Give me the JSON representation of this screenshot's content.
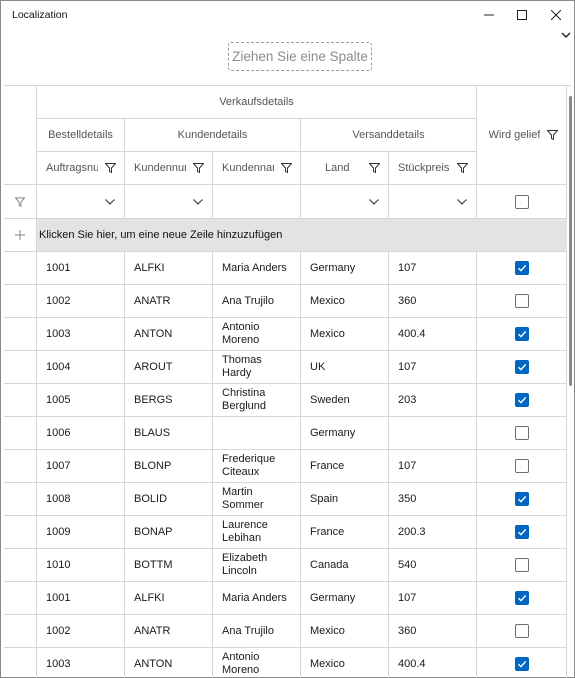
{
  "window": {
    "title": "Localization",
    "controls": [
      "minimize-icon",
      "maximize-icon",
      "close-icon"
    ]
  },
  "group_panel": {
    "placeholder": "Ziehen Sie eine Spalte"
  },
  "headers": {
    "band_top": "Verkaufsdetails",
    "band_order": "Bestelldetails",
    "band_customer": "Kundendetails",
    "band_shipping": "Versanddetails",
    "delivered": "Wird gelief",
    "order_id": "Auftragsnu",
    "customer_id": "Kundennur",
    "customer_name": "Kundennar",
    "country": "Land",
    "unit_price": "Stückpreis"
  },
  "add_row_text": "Klicken Sie hier, um eine neue Zeile hinzuzufügen",
  "rows": [
    {
      "order_id": "1001",
      "customer_id": "ALFKI",
      "customer_name": "Maria Anders",
      "country": "Germany",
      "unit_price": "107",
      "delivered": true
    },
    {
      "order_id": "1002",
      "customer_id": "ANATR",
      "customer_name": "Ana Trujilo",
      "country": "Mexico",
      "unit_price": "360",
      "delivered": false
    },
    {
      "order_id": "1003",
      "customer_id": "ANTON",
      "customer_name": "Antonio Moreno",
      "country": "Mexico",
      "unit_price": "400.4",
      "delivered": true
    },
    {
      "order_id": "1004",
      "customer_id": "AROUT",
      "customer_name": "Thomas Hardy",
      "country": "UK",
      "unit_price": "107",
      "delivered": true
    },
    {
      "order_id": "1005",
      "customer_id": "BERGS",
      "customer_name": "Christina Berglund",
      "country": "Sweden",
      "unit_price": "203",
      "delivered": true
    },
    {
      "order_id": "1006",
      "customer_id": "BLAUS",
      "customer_name": "",
      "country": "Germany",
      "unit_price": "",
      "delivered": false
    },
    {
      "order_id": "1007",
      "customer_id": "BLONP",
      "customer_name": "Frederique Citeaux",
      "country": "France",
      "unit_price": "107",
      "delivered": false
    },
    {
      "order_id": "1008",
      "customer_id": "BOLID",
      "customer_name": "Martin Sommer",
      "country": "Spain",
      "unit_price": "350",
      "delivered": true
    },
    {
      "order_id": "1009",
      "customer_id": "BONAP",
      "customer_name": "Laurence Lebihan",
      "country": "France",
      "unit_price": "200.3",
      "delivered": true
    },
    {
      "order_id": "1010",
      "customer_id": "BOTTM",
      "customer_name": "Elizabeth Lincoln",
      "country": "Canada",
      "unit_price": "540",
      "delivered": false
    },
    {
      "order_id": "1001",
      "customer_id": "ALFKI",
      "customer_name": "Maria Anders",
      "country": "Germany",
      "unit_price": "107",
      "delivered": true
    },
    {
      "order_id": "1002",
      "customer_id": "ANATR",
      "customer_name": "Ana Trujilo",
      "country": "Mexico",
      "unit_price": "360",
      "delivered": false
    },
    {
      "order_id": "1003",
      "customer_id": "ANTON",
      "customer_name": "Antonio Moreno",
      "country": "Mexico",
      "unit_price": "400.4",
      "delivered": true
    }
  ],
  "colors": {
    "accent": "#0067c0",
    "grid_line": "#d6d6d6",
    "add_row_bg": "#e3e3e3",
    "header_text": "#555555"
  }
}
